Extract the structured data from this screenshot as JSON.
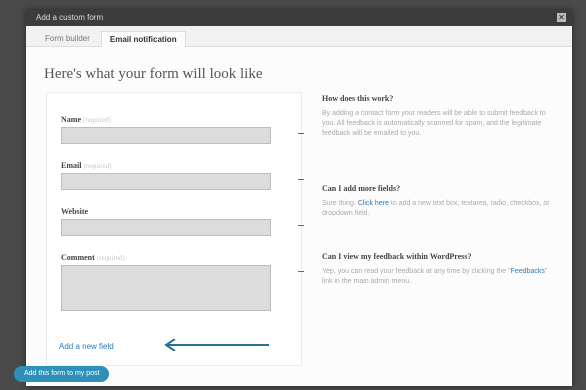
{
  "window": {
    "title": "Add a custom form"
  },
  "tabs": [
    {
      "label": "Form builder"
    },
    {
      "label": "Email notification"
    }
  ],
  "heading": "Here's what your form will look like",
  "fields": [
    {
      "label": "Name",
      "required": "(required)"
    },
    {
      "label": "Email",
      "required": "(required)"
    },
    {
      "label": "Website",
      "required": ""
    },
    {
      "label": "Comment",
      "required": "(required)"
    }
  ],
  "add_field": "Add a new field",
  "faq": [
    {
      "question": "How does this work?",
      "answer": "By adding a contact form your readers will be able to submit feedback to you. All feedback is automatically scanned for spam, and the legitimate feedback will be emailed to you."
    },
    {
      "question": "Can I add more fields?",
      "answer_before": "Sure thing. ",
      "answer_link": "Click here",
      "answer_after": " to add a new text box, textarea, radio, checkbox, or dropdown field."
    },
    {
      "question": "Can I view my feedback within WordPress?",
      "answer_before": "Yep, you can read your feedback at any time by clicking the \"",
      "answer_link": "Feedbacks",
      "answer_after": "\" link in the main admin menu."
    }
  ],
  "submit_label": "Add this form to my post",
  "colors": {
    "accent": "#2e8fb9",
    "link": "#2b7bb9",
    "titlebar": "#3c3c3c"
  }
}
